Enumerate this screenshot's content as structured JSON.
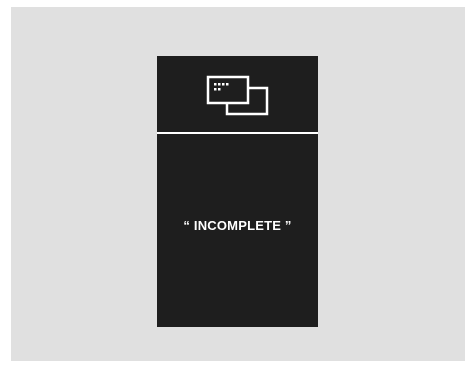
{
  "screen": {
    "background_color": "#e0e0e0",
    "display_color": "#1e1e1e",
    "text_color": "#ffffff"
  },
  "header": {
    "icon": "screen-mirroring-icon"
  },
  "status": {
    "message": "“ INCOMPLETE ”"
  }
}
